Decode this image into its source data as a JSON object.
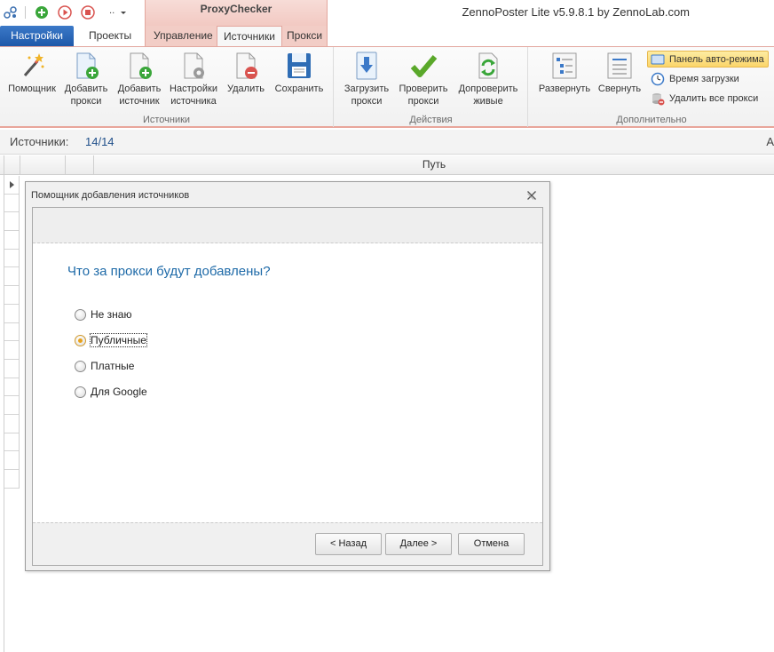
{
  "window": {
    "context_tab_group": "ProxyChecker",
    "app_title": "ZennoPoster Lite v5.9.8.1 by ZennoLab.com"
  },
  "quick_access": {
    "icons": [
      "network-icon",
      "add-icon",
      "play-icon",
      "stop-icon",
      "more-icon",
      "dropdown-icon"
    ]
  },
  "tabs": [
    {
      "label": "Настройки",
      "type": "file"
    },
    {
      "label": "Проекты"
    },
    {
      "label": "Управление"
    },
    {
      "label": "Источники",
      "active": true
    },
    {
      "label": "Прокси"
    }
  ],
  "ribbon": {
    "groups": [
      {
        "label": "Источники",
        "buttons": [
          {
            "label": "Помощник",
            "icon": "wizard-icon"
          },
          {
            "label": "Добавить прокси",
            "icon": "add-proxy-icon"
          },
          {
            "label": "Добавить источник",
            "icon": "add-source-icon"
          },
          {
            "label": "Настройки источника",
            "icon": "source-settings-icon"
          },
          {
            "label": "Удалить",
            "icon": "delete-icon"
          },
          {
            "label": "Сохранить",
            "icon": "save-icon"
          }
        ]
      },
      {
        "label": "Действия",
        "buttons": [
          {
            "label": "Загрузить прокси",
            "icon": "download-icon"
          },
          {
            "label": "Проверить прокси",
            "icon": "check-icon"
          },
          {
            "label": "Допроверить живые",
            "icon": "recheck-icon"
          }
        ]
      },
      {
        "label": "Дополнительно",
        "buttons": [
          {
            "label": "Развернуть",
            "icon": "expand-icon"
          },
          {
            "label": "Свернуть",
            "icon": "collapse-icon"
          }
        ],
        "small_buttons": [
          {
            "label": "Панель авто-режима",
            "icon": "panel-icon",
            "highlighted": true
          },
          {
            "label": "Время загрузки",
            "icon": "clock-icon"
          },
          {
            "label": "Удалить все прокси",
            "icon": "delete-all-icon"
          }
        ]
      }
    ]
  },
  "status": {
    "label": "Источники:",
    "value": "14/14",
    "edge_text": "А"
  },
  "grid": {
    "path_header": "Путь"
  },
  "dialog": {
    "title": "Помощник добавления источников",
    "question": "Что за прокси будут добавлены?",
    "options": [
      {
        "label": "Не знаю",
        "checked": false
      },
      {
        "label": "Публичные",
        "checked": true
      },
      {
        "label": "Платные",
        "checked": false
      },
      {
        "label": "Для Google",
        "checked": false
      }
    ],
    "buttons": {
      "back": "< Назад",
      "next": "Далее >",
      "cancel": "Отмена"
    }
  },
  "colors": {
    "accent": "#1e6aa8",
    "file_tab": "#2a67b8",
    "context_tab": "#f2cdc6",
    "radio_checked": "#e9a21a"
  }
}
